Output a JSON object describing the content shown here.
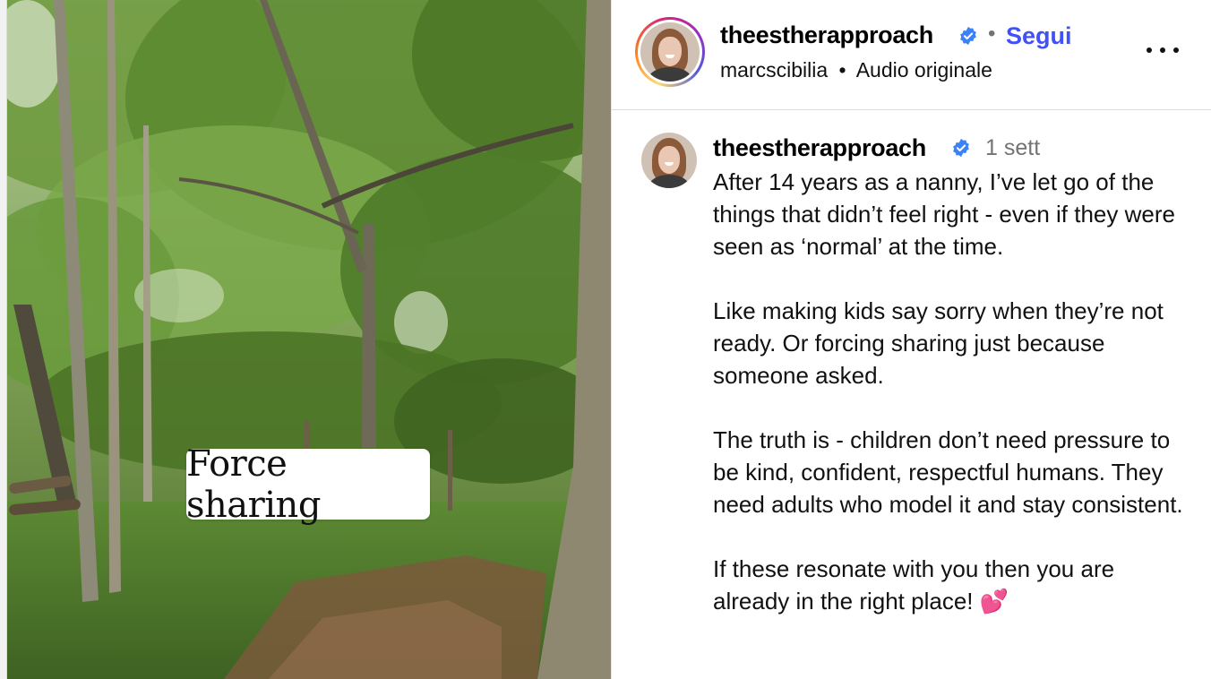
{
  "media": {
    "overlay_text": "Force sharing"
  },
  "header": {
    "username": "theestherapproach",
    "separator": "•",
    "follow_label": "Segui",
    "audio_user": "marcscibilia",
    "audio_sep": "•",
    "audio_label": "Audio originale",
    "more_icon": "more-horizontal-icon"
  },
  "post": {
    "username": "theestherapproach",
    "time_ago": "1 sett",
    "caption_paragraphs": [
      "After 14 years as a nanny, I’ve let go of the things that didn’t feel right - even if they were seen as ‘normal’ at the time.",
      "Like making kids say sorry when they’re not ready. Or forcing sharing just because someone asked.",
      "The truth is - children don’t need pressure to be kind, confident, respectful humans. They need adults who model it and stay consistent.",
      "If these resonate with you then you are already in the right place!"
    ],
    "emoji": "💕"
  },
  "colors": {
    "follow": "#4150f7",
    "verified": "#3b82f6",
    "muted": "#737373"
  }
}
